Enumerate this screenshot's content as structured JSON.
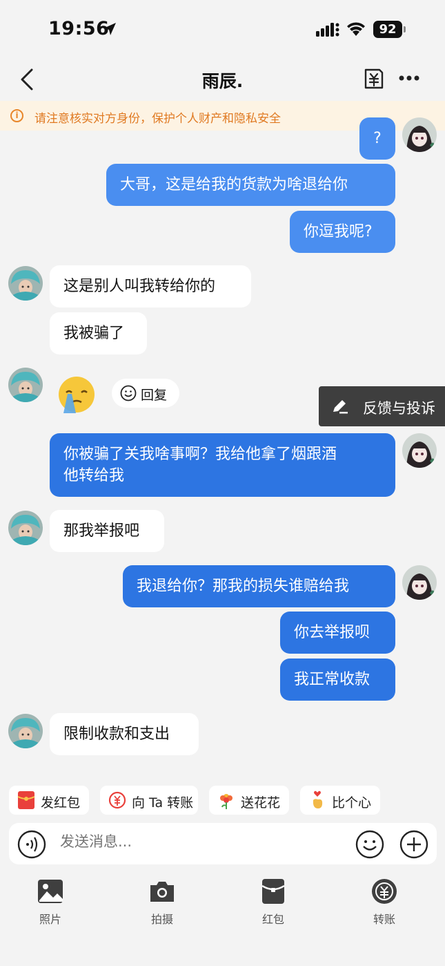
{
  "status_bar": {
    "time": "19:56",
    "battery": "92"
  },
  "header": {
    "title": "雨辰."
  },
  "banner": {
    "text": "请注意核实对方身份，保护个人财产和隐私安全"
  },
  "messages": {
    "m0": "?",
    "m1": "大哥，这是给我的货款为啥退给你",
    "m2": "你逗我呢?",
    "m3": "这是别人叫我转给你的",
    "m4": "我被骗了",
    "m6_line1": "你被骗了关我啥事啊？我给他拿了烟跟酒",
    "m6_line2": "他转给我",
    "m7": "那我举报吧",
    "m8": "我退给你？那我的损失谁赔给我",
    "m9": "你去举报呗",
    "m10": "我正常收款",
    "m11": "限制收款和支出"
  },
  "reply_button": {
    "label": "回复"
  },
  "feedback": {
    "label": "反馈与投诉"
  },
  "quick_actions": [
    {
      "label": "发红包"
    },
    {
      "label": "向 Ta 转账"
    },
    {
      "label": "送花花"
    },
    {
      "label": "比个心"
    }
  ],
  "input": {
    "placeholder": "发送消息..."
  },
  "toolbar": [
    {
      "label": "照片"
    },
    {
      "label": "拍摄"
    },
    {
      "label": "红包"
    },
    {
      "label": "转账"
    }
  ],
  "colors": {
    "outgoing_light": "#4a8ef0",
    "outgoing_dark": "#2d75e2",
    "banner_bg": "#fdf3e3",
    "banner_text": "#e07a22",
    "red_packet": "#e9403b"
  }
}
